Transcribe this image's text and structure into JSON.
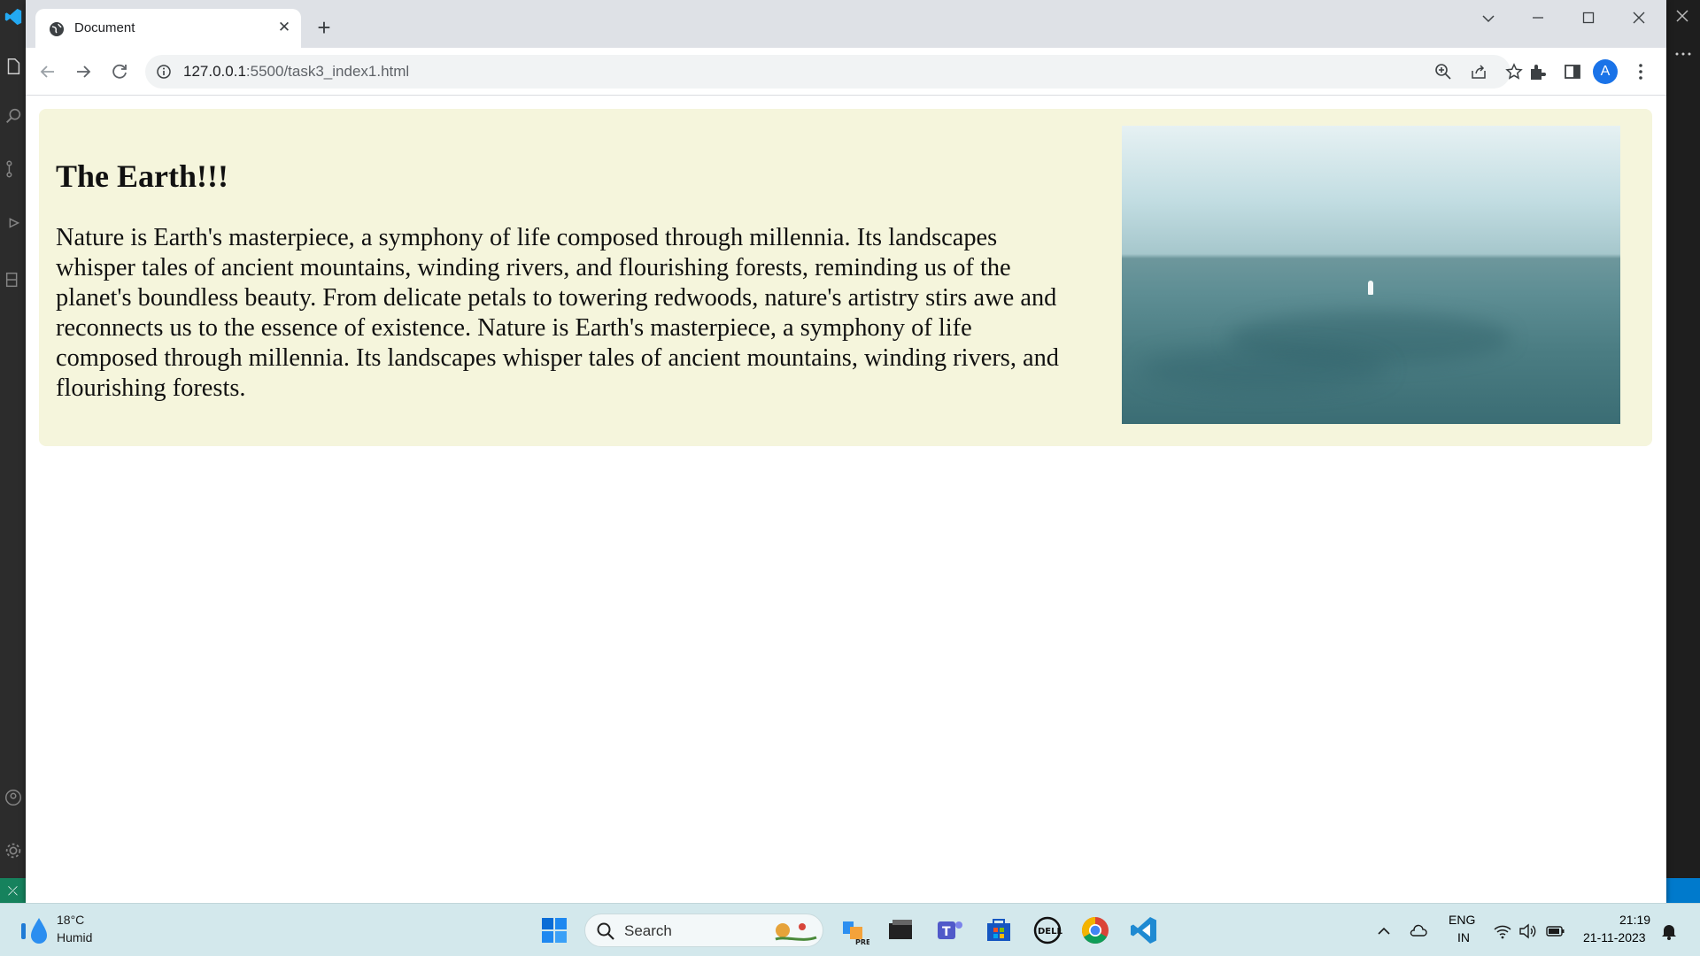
{
  "browser": {
    "tab_title": "Document",
    "url_host": "127.0.0.1",
    "url_rest": ":5500/task3_index1.html",
    "avatar_letter": "A"
  },
  "page": {
    "heading": "The Earth!!!",
    "paragraph": "Nature is Earth's masterpiece, a symphony of life composed through millennia. Its landscapes whisper tales of ancient mountains, winding rivers, and flourishing forests, reminding us of the planet's boundless beauty. From delicate petals to towering redwoods, nature's artistry stirs awe and reconnects us to the essence of existence. Nature is Earth's masterpiece, a symphony of life composed through millennia. Its landscapes whisper tales of ancient mountains, winding rivers, and flourishing forests.",
    "card_color": "#f5f5dc"
  },
  "taskbar": {
    "weather_temp": "18°C",
    "weather_desc": "Humid",
    "search_label": "Search",
    "lang_line1": "ENG",
    "lang_line2": "IN",
    "time": "21:19",
    "date": "21-11-2023"
  },
  "icons": [
    "globe-icon",
    "close-icon",
    "plus-icon",
    "chevron-down-icon",
    "minimize-icon",
    "maximize-icon",
    "back-arrow-icon",
    "forward-arrow-icon",
    "reload-icon",
    "info-icon",
    "zoom-icon",
    "share-icon",
    "star-icon",
    "extensions-icon",
    "side-panel-icon",
    "more-vert-icon",
    "windows-start-icon",
    "search-icon",
    "copilot-icon",
    "file-explorer-icon",
    "teams-icon",
    "store-icon",
    "dell-icon",
    "chrome-icon",
    "vscode-icon",
    "chevron-up-icon",
    "onedrive-icon",
    "wifi-icon",
    "volume-icon",
    "battery-icon",
    "notification-bell-icon"
  ]
}
